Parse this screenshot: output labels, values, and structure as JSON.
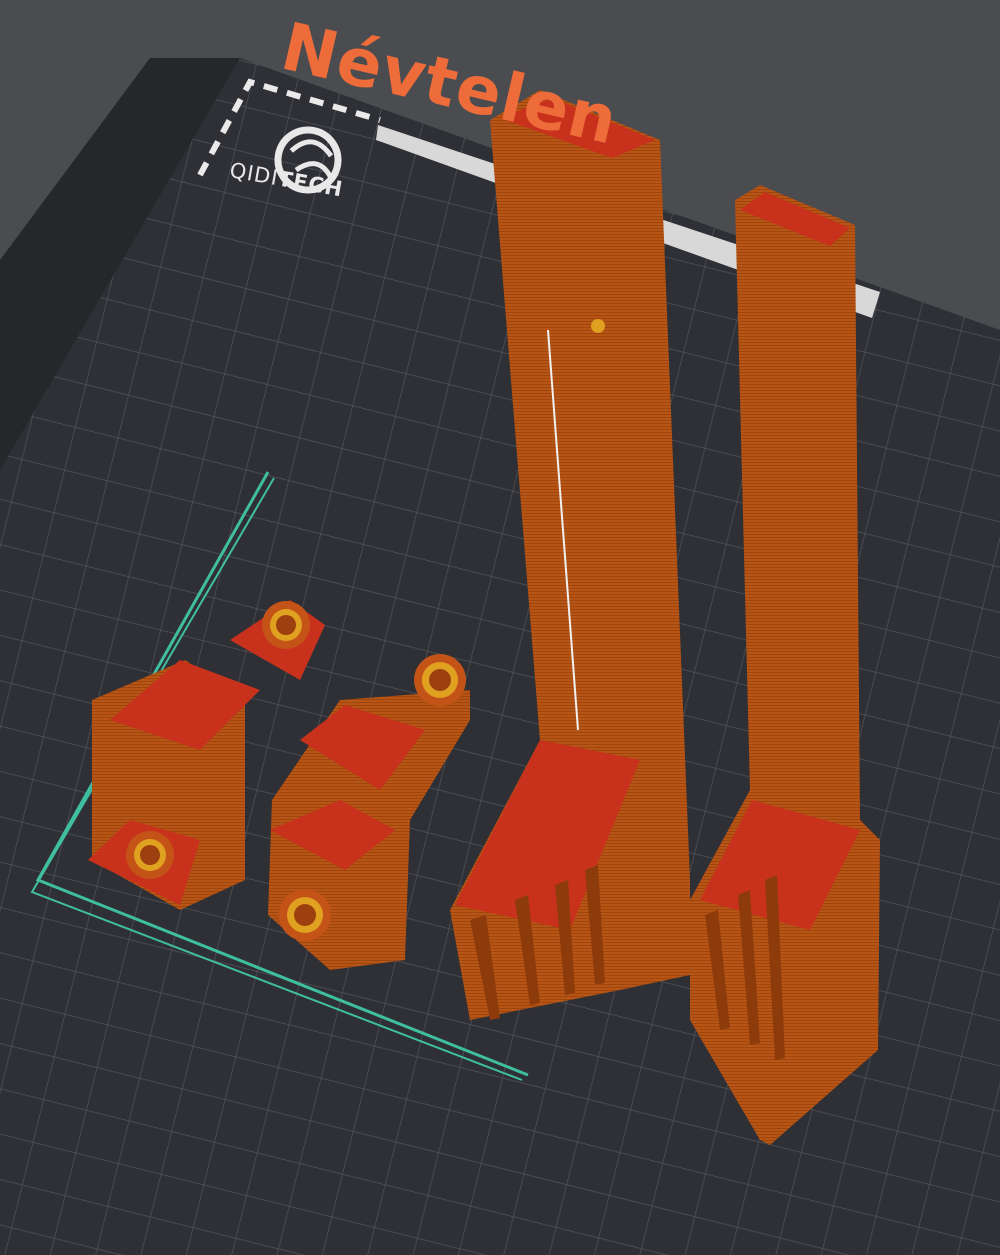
{
  "project": {
    "title": "Névtelen"
  },
  "brand": {
    "prefix": "QIDI",
    "suffix": "TECH"
  },
  "icons": {
    "brand_logo": "qidi-swirl-logo"
  },
  "colors": {
    "background": "#4b4c50",
    "bed": "#2f3035",
    "grid_line": "#52545b",
    "accent": "#ee6b3a",
    "selection": "#3fbf9f",
    "model_body": "#b85414",
    "model_top": "#c8321c",
    "model_edge": "#e0a020"
  }
}
